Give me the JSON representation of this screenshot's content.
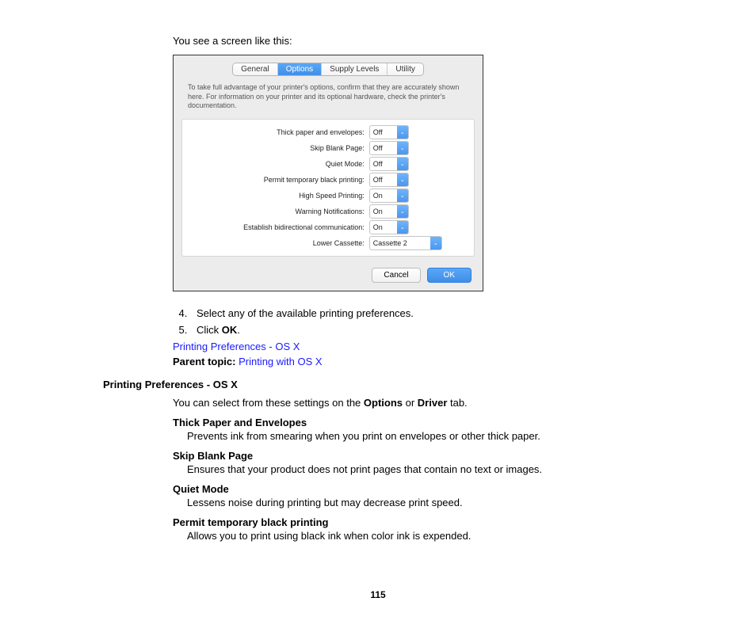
{
  "intro_text": "You see a screen like this:",
  "dialog": {
    "tabs": [
      "General",
      "Options",
      "Supply Levels",
      "Utility"
    ],
    "selected_tab_index": 1,
    "description": "To take full advantage of your printer's options, confirm that they are accurately shown here. For information on your printer and its optional hardware, check the printer's documentation.",
    "settings": [
      {
        "label": "Thick paper and envelopes:",
        "value": "Off",
        "width": "small"
      },
      {
        "label": "Skip Blank Page:",
        "value": "Off",
        "width": "small"
      },
      {
        "label": "Quiet Mode:",
        "value": "Off",
        "width": "small"
      },
      {
        "label": "Permit temporary black printing:",
        "value": "Off",
        "width": "small"
      },
      {
        "label": "High Speed Printing:",
        "value": "On",
        "width": "small"
      },
      {
        "label": "Warning Notifications:",
        "value": "On",
        "width": "small"
      },
      {
        "label": "Establish bidirectional communication:",
        "value": "On",
        "width": "small"
      },
      {
        "label": "Lower Cassette:",
        "value": "Cassette 2",
        "width": "wide"
      }
    ],
    "cancel": "Cancel",
    "ok": "OK"
  },
  "steps": {
    "s4": "Select any of the available printing preferences.",
    "s5a": "Click ",
    "s5b": "OK",
    "s5c": "."
  },
  "link1": "Printing Preferences - OS X",
  "parent_label": "Parent topic: ",
  "parent_link": "Printing with OS X",
  "section_heading": "Printing Preferences - OS X",
  "settings_intro_a": "You can select from these settings on the ",
  "settings_intro_b": "Options",
  "settings_intro_c": " or ",
  "settings_intro_d": "Driver",
  "settings_intro_e": " tab.",
  "defs": [
    {
      "term": "Thick Paper and Envelopes",
      "desc": "Prevents ink from smearing when you print on envelopes or other thick paper."
    },
    {
      "term": "Skip Blank Page",
      "desc": "Ensures that your product does not print pages that contain no text or images."
    },
    {
      "term": "Quiet Mode",
      "desc": "Lessens noise during printing but may decrease print speed."
    },
    {
      "term": "Permit temporary black printing",
      "desc": "Allows you to print using black ink when color ink is expended."
    }
  ],
  "page_number": "115"
}
